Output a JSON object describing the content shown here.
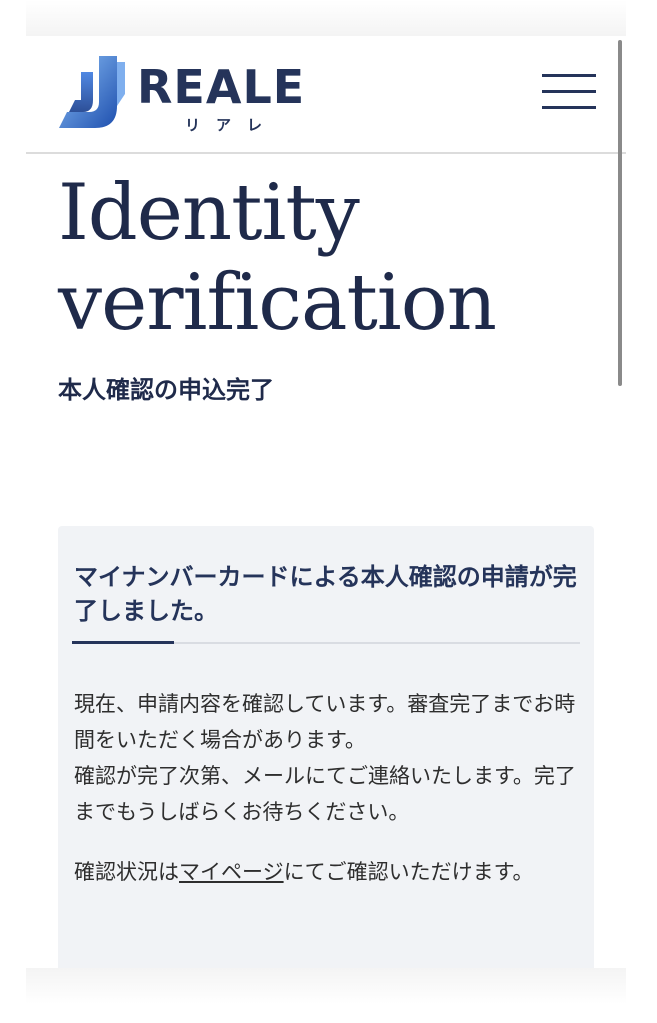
{
  "header": {
    "logo_text": "REALE",
    "logo_kana": "リアレ",
    "menu_icon": "hamburger-menu-icon"
  },
  "page": {
    "title_line1": "Identity",
    "title_line2": "verification",
    "subtitle": "本人確認の申込完了"
  },
  "card": {
    "heading": "マイナンバーカードによる本人確認の申請が完了しました。",
    "body_1": "現在、申請内容を確認しています。審査完了までお時間をいただく場合があります。",
    "body_2": "確認が完了次第、メールにてご連絡いたします。完了までもうしばらくお待ちください。",
    "status_prefix": "確認状況は",
    "mypage_link": "マイページ",
    "status_suffix": "にてご確認いただけます。"
  },
  "colors": {
    "brand_navy": "#25345a",
    "card_background": "#f1f3f6",
    "logo_blue_light": "#6aa6f0",
    "logo_blue_dark": "#1e4fae"
  }
}
